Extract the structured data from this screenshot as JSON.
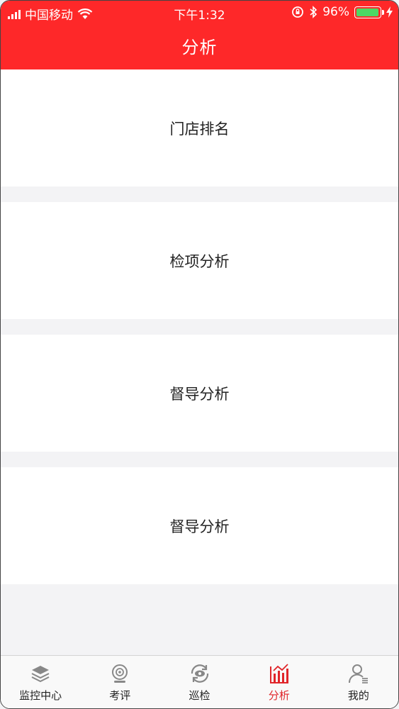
{
  "status_bar": {
    "carrier": "中国移动",
    "time": "下午1:32",
    "battery_percent": "96%",
    "battery_level": 0.96
  },
  "header": {
    "title": "分析"
  },
  "cards": [
    {
      "label": "门店排名"
    },
    {
      "label": "检项分析"
    },
    {
      "label": "督导分析"
    },
    {
      "label": "督导分析"
    }
  ],
  "tabbar": {
    "items": [
      {
        "label": "监控中心",
        "icon": "layers-icon"
      },
      {
        "label": "考评",
        "icon": "webcam-icon"
      },
      {
        "label": "巡检",
        "icon": "patrol-icon"
      },
      {
        "label": "分析",
        "icon": "bar-chart-icon",
        "active": true
      },
      {
        "label": "我的",
        "icon": "user-icon"
      }
    ]
  },
  "colors": {
    "brand_red": "#fe2829",
    "active_tab": "#e0252a",
    "background": "#f3f3f5"
  }
}
